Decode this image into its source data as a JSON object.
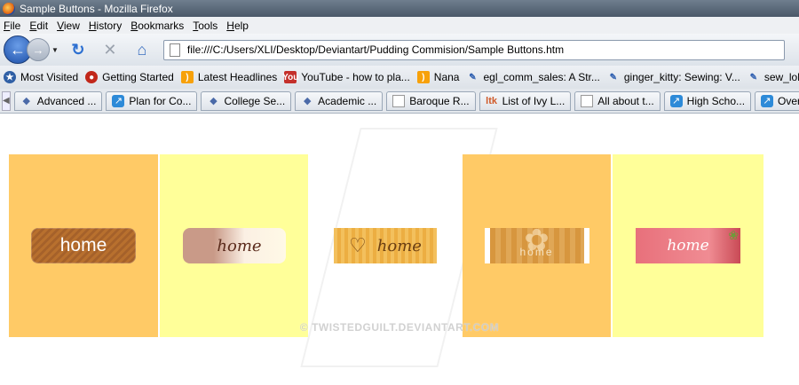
{
  "window": {
    "title": "Sample Buttons - Mozilla Firefox"
  },
  "menu": [
    "File",
    "Edit",
    "View",
    "History",
    "Bookmarks",
    "Tools",
    "Help"
  ],
  "nav": {
    "url": "file:///C:/Users/XLI/Desktop/Deviantart/Pudding Commision/Sample Buttons.htm"
  },
  "bookmarks": [
    {
      "label": "Most Visited",
      "icon": "most-visited-icon"
    },
    {
      "label": "Getting Started",
      "icon": "getting-started-icon"
    },
    {
      "label": "Latest Headlines",
      "icon": "rss-icon"
    },
    {
      "label": "YouTube - how to pla...",
      "icon": "youtube-icon"
    },
    {
      "label": "Nana",
      "icon": "rss-icon"
    },
    {
      "label": "egl_comm_sales: A Str...",
      "icon": "pin-icon"
    },
    {
      "label": "ginger_kitty: Sewing: V...",
      "icon": "pin-icon"
    },
    {
      "label": "sew_loli: N",
      "icon": "pin-icon"
    }
  ],
  "tabs": [
    {
      "label": "Advanced ...",
      "icon": "diamond-icon"
    },
    {
      "label": "Plan for Co...",
      "icon": "blue-page-icon"
    },
    {
      "label": "College Se...",
      "icon": "diamond-icon"
    },
    {
      "label": "Academic ...",
      "icon": "diamond-icon"
    },
    {
      "label": "Baroque R...",
      "icon": "page-icon"
    },
    {
      "label": "List of Ivy L...",
      "icon": "ltk-icon"
    },
    {
      "label": "All about t...",
      "icon": "page-icon"
    },
    {
      "label": "High Scho...",
      "icon": "blue-page-icon"
    },
    {
      "label": "Overachiev...",
      "icon": "blue-page-icon"
    }
  ],
  "buttons": [
    "home",
    "home",
    "home",
    "home",
    "home"
  ],
  "watermark": "© TWISTEDGUILT.DEVIANTART.COM",
  "colors": {
    "orange_panel": "#ffca66",
    "yellow_panel": "#ffff99"
  }
}
